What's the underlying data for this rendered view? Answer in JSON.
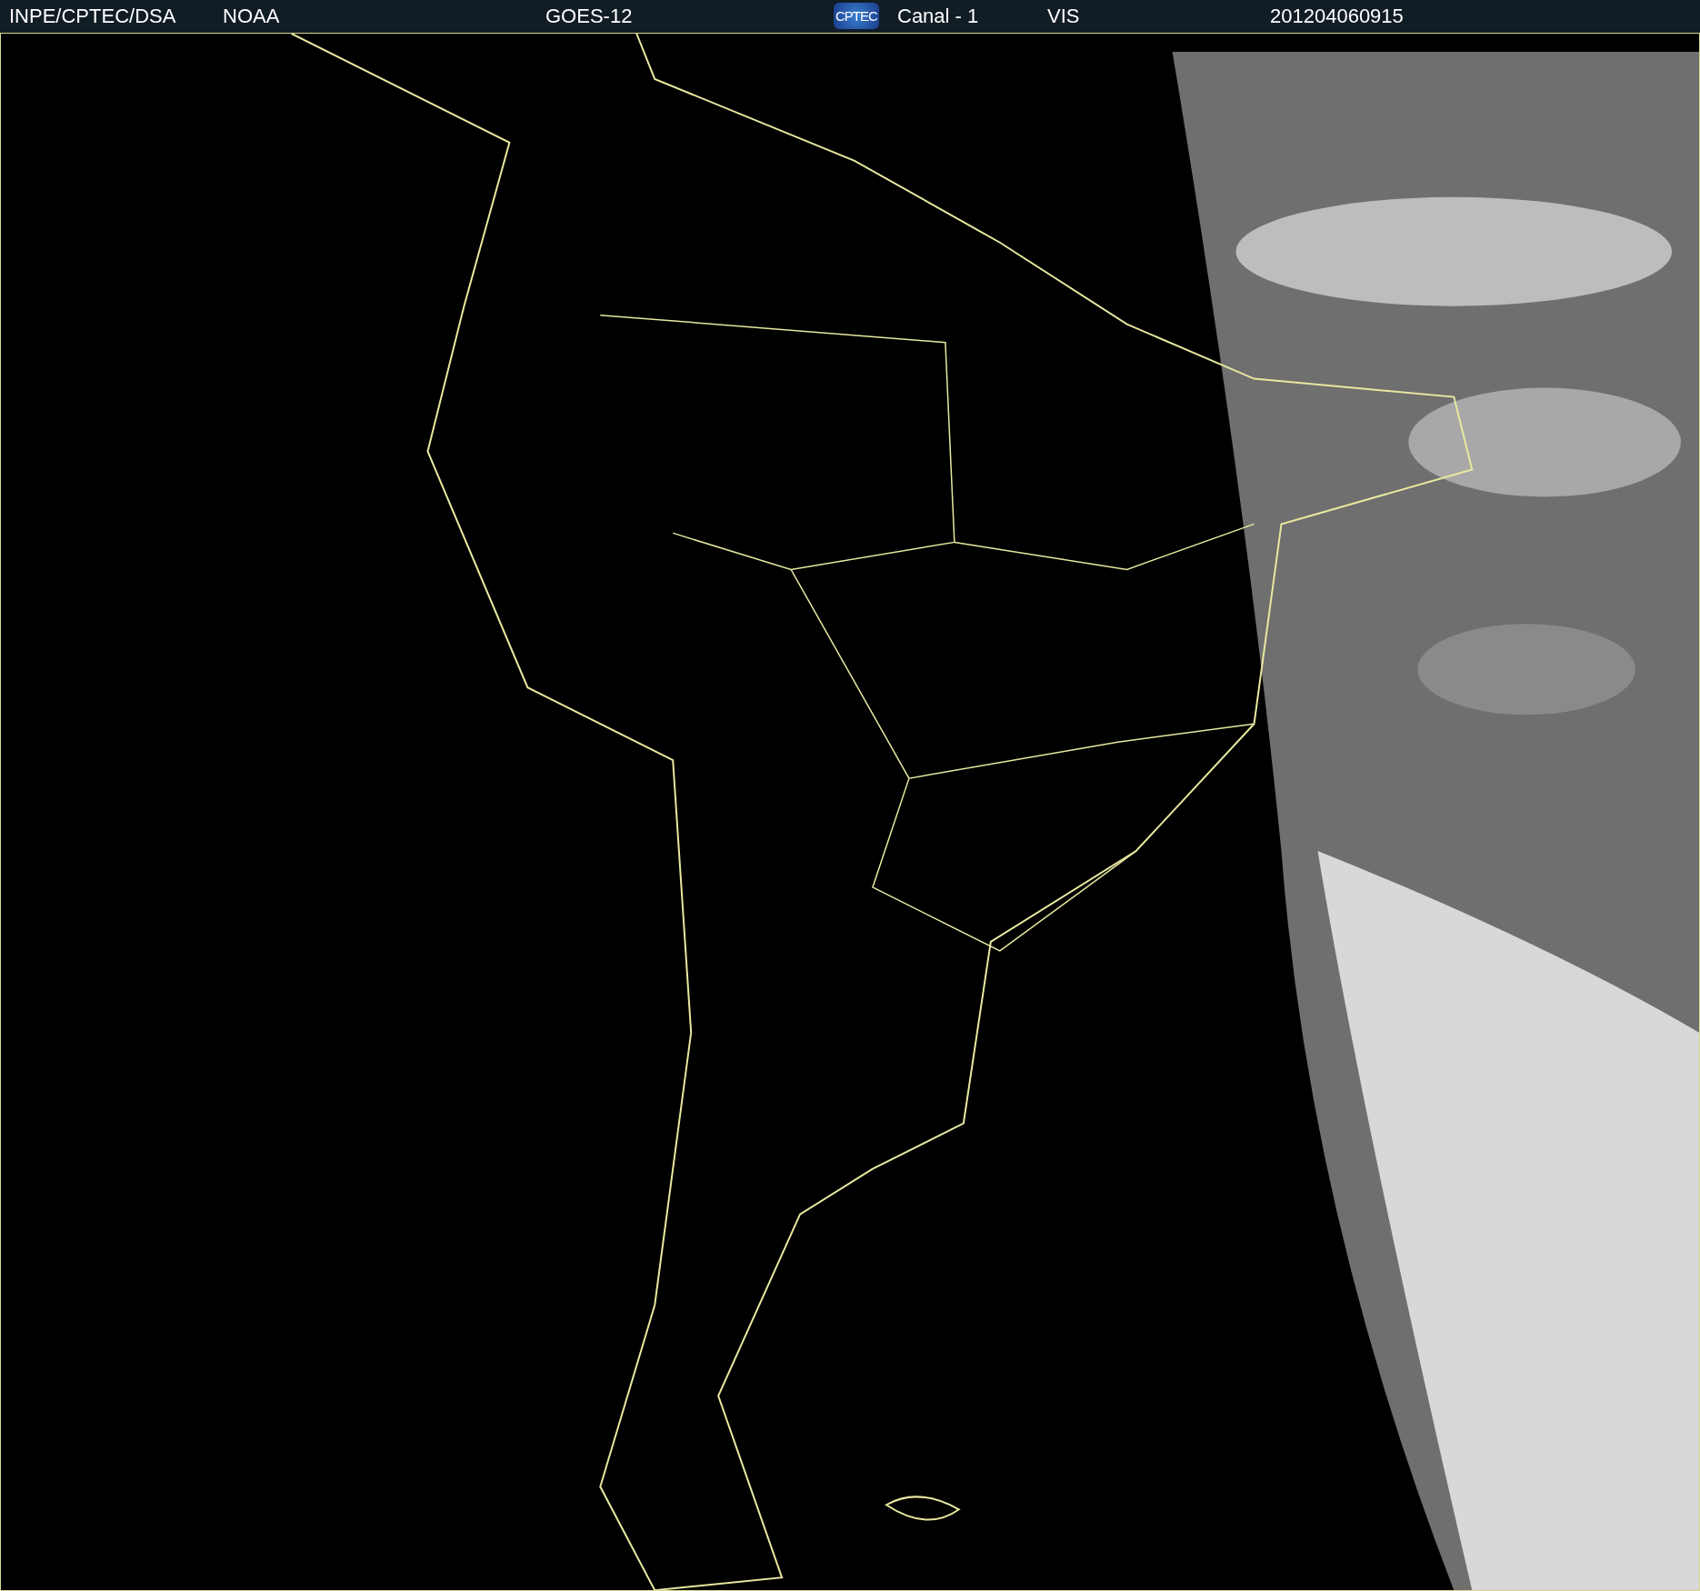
{
  "header": {
    "source": "INPE/CPTEC/DSA",
    "agency": "NOAA",
    "satellite": "GOES-12",
    "logo": "CPTEC",
    "channel": "Canal - 1",
    "band": "VIS",
    "timestamp": "201204060915"
  }
}
